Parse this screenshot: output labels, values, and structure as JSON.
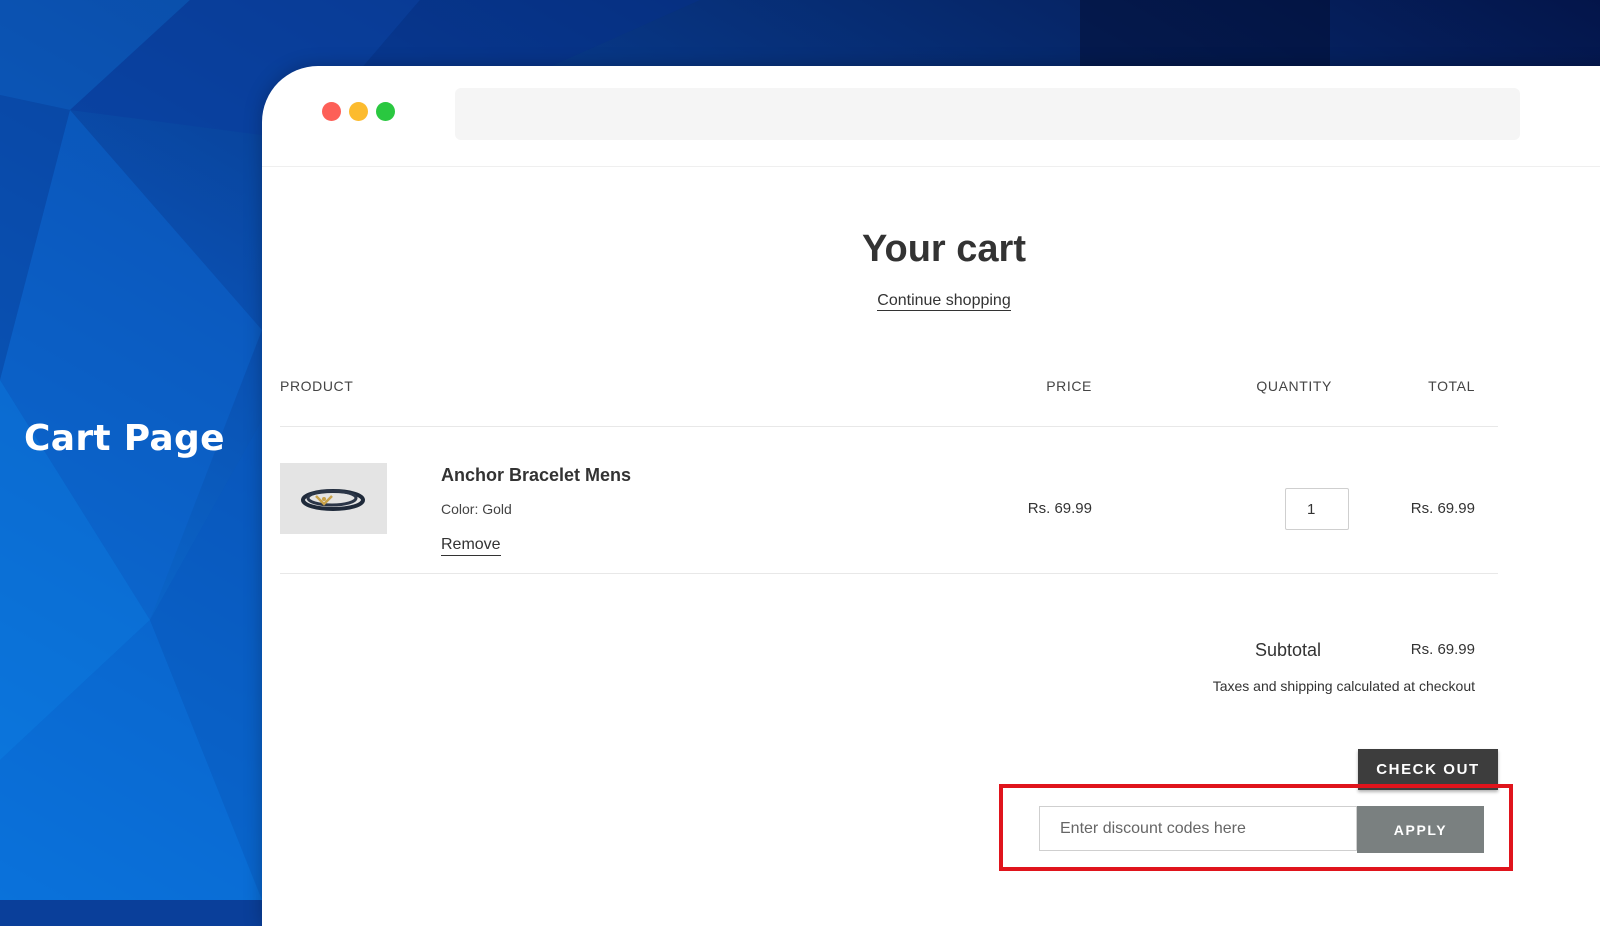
{
  "slide": {
    "label": "Cart Page"
  },
  "window": {
    "address_bar_text": ""
  },
  "cart": {
    "title": "Your cart",
    "continue_shopping": "Continue shopping",
    "columns": {
      "product": "PRODUCT",
      "price": "PRICE",
      "quantity": "QUANTITY",
      "total": "TOTAL"
    },
    "items": [
      {
        "name": "Anchor Bracelet Mens",
        "variant": "Color: Gold",
        "remove_label": "Remove",
        "price": "Rs. 69.99",
        "quantity": "1",
        "total": "Rs. 69.99"
      }
    ],
    "subtotal_label": "Subtotal",
    "subtotal_value": "Rs. 69.99",
    "tax_note": "Taxes and shipping calculated at checkout",
    "checkout_label": "CHECK OUT",
    "discount": {
      "placeholder": "Enter discount codes here",
      "apply_label": "APPLY"
    }
  },
  "colors": {
    "highlight": "#e0141c",
    "checkout_bg": "#3d3d3d",
    "apply_bg": "#7a8080",
    "traffic_red": "#fd5f57",
    "traffic_yellow": "#fcbb2e",
    "traffic_green": "#2ac840"
  }
}
